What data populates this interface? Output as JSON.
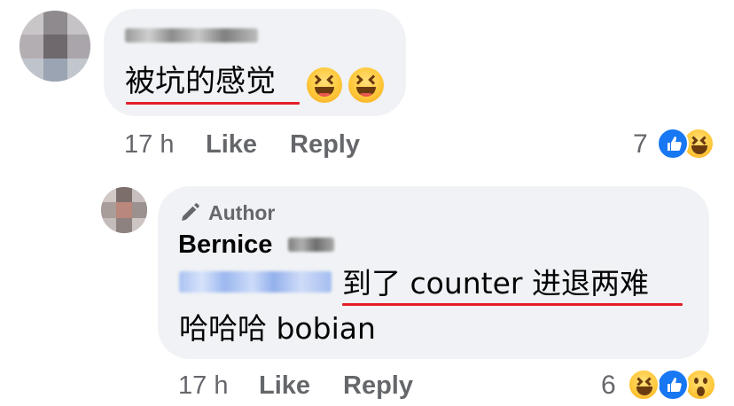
{
  "comment1": {
    "text": "被坑的感觉",
    "emojis": [
      "grinning-squinting-face",
      "grinning-squinting-face"
    ],
    "time": "17 h",
    "like_label": "Like",
    "reply_label": "Reply",
    "reaction_count": "7",
    "reactions": [
      "like",
      "haha"
    ]
  },
  "comment2": {
    "author_badge": "Author",
    "author_name": "Bernice",
    "text_line1": "到了 counter 进退两难",
    "text_line2": "哈哈哈 bobian",
    "time": "17 h",
    "like_label": "Like",
    "reply_label": "Reply",
    "reaction_count": "6",
    "reactions": [
      "haha",
      "like",
      "wow"
    ]
  },
  "colors": {
    "bubble": "#f0f2f5",
    "meta_text": "#65676b",
    "underline": "#e41e26",
    "like_blue": "#1877f2"
  }
}
